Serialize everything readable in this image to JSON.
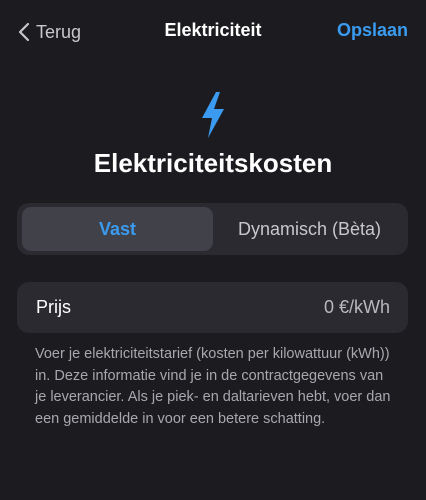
{
  "nav": {
    "back_label": "Terug",
    "title": "Elektriciteit",
    "save_label": "Opslaan"
  },
  "icons": {
    "back": "chevron-left-icon",
    "header": "lightning-bolt-icon"
  },
  "colors": {
    "background": "#1c1c20",
    "card": "#2a2a30",
    "segment_active": "#414149",
    "accent": "#3a9bf0"
  },
  "heading": "Elektriciteitskosten",
  "segments": {
    "selected": "Vast",
    "options": [
      "Vast",
      "Dynamisch (Bèta)"
    ]
  },
  "price": {
    "label": "Prijs",
    "value": "0 €/kWh"
  },
  "help_text": "Voer je elektriciteitstarief (kosten per kilowattuur (kWh)) in. Deze informatie vind je in de contractgegevens van je leverancier. Als je piek- en daltarieven hebt, voer dan een gemiddelde in voor een betere schatting."
}
